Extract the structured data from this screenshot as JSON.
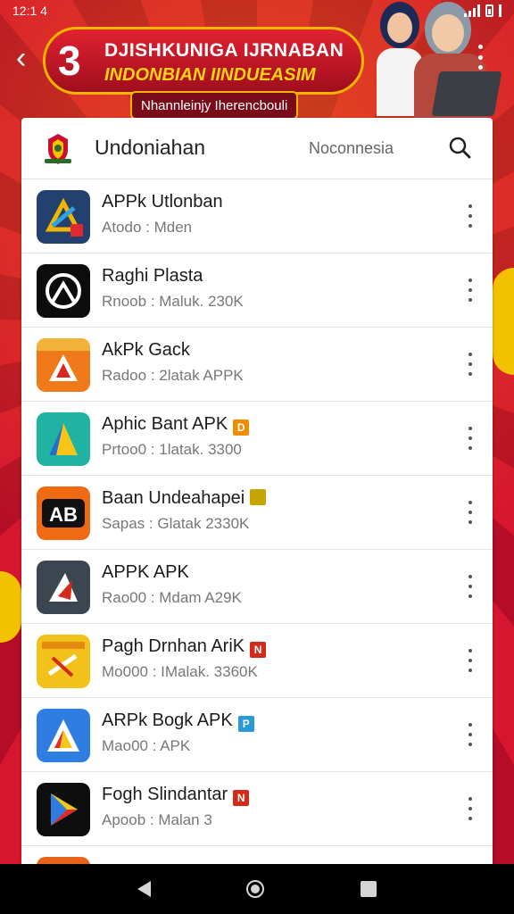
{
  "status_bar": {
    "time": "12:1 4"
  },
  "banner": {
    "number": "3",
    "line1": "DJISHKUNIGA IJRNABAN",
    "line2": "INDONBIAN IINDUEASIM",
    "subtitle": "Nhannleinjy Iherencbouli"
  },
  "card": {
    "title": "Undoniahan",
    "subtitle": "Noconnesia"
  },
  "apps": [
    {
      "name": "APPk Utlonban",
      "meta": "Atodo : Mden",
      "badge": "",
      "badge_color": ""
    },
    {
      "name": "Raghi Plasta",
      "meta": "Rnoob : Maluk. 230K",
      "badge": "",
      "badge_color": ""
    },
    {
      "name": "AkPk Gack",
      "meta": "Radoo : 2latak APPK",
      "badge": "",
      "badge_color": ""
    },
    {
      "name": "Aphic Bant APK",
      "meta": "Prtoo0 : 1latak. 3300",
      "badge": "D",
      "badge_color": "#f08c00"
    },
    {
      "name": "Baan Undeahapei",
      "meta": "Sapas : Glatak 2330K",
      "badge": "",
      "badge_color": "#c8a400"
    },
    {
      "name": "APPK APK",
      "meta": "Rao00 : Mdam A29K",
      "badge": "",
      "badge_color": ""
    },
    {
      "name": "Pagh Drnhan AriK",
      "meta": "Mo000 : IMalak. 3360K",
      "badge": "N",
      "badge_color": "#d32a1a"
    },
    {
      "name": "ARPk Bogk APK",
      "meta": "Mao00 : APK",
      "badge": "P",
      "badge_color": "#2a9bd8"
    },
    {
      "name": "Fogh Slindantar",
      "meta": "Apoob : Malan 3",
      "badge": "N",
      "badge_color": "#d32a1a"
    }
  ],
  "icons": {
    "back": "back-arrow-icon",
    "more": "more-vert-icon",
    "search": "search-icon"
  },
  "colors": {
    "background": "#c8102e",
    "accent": "#f6b500"
  }
}
